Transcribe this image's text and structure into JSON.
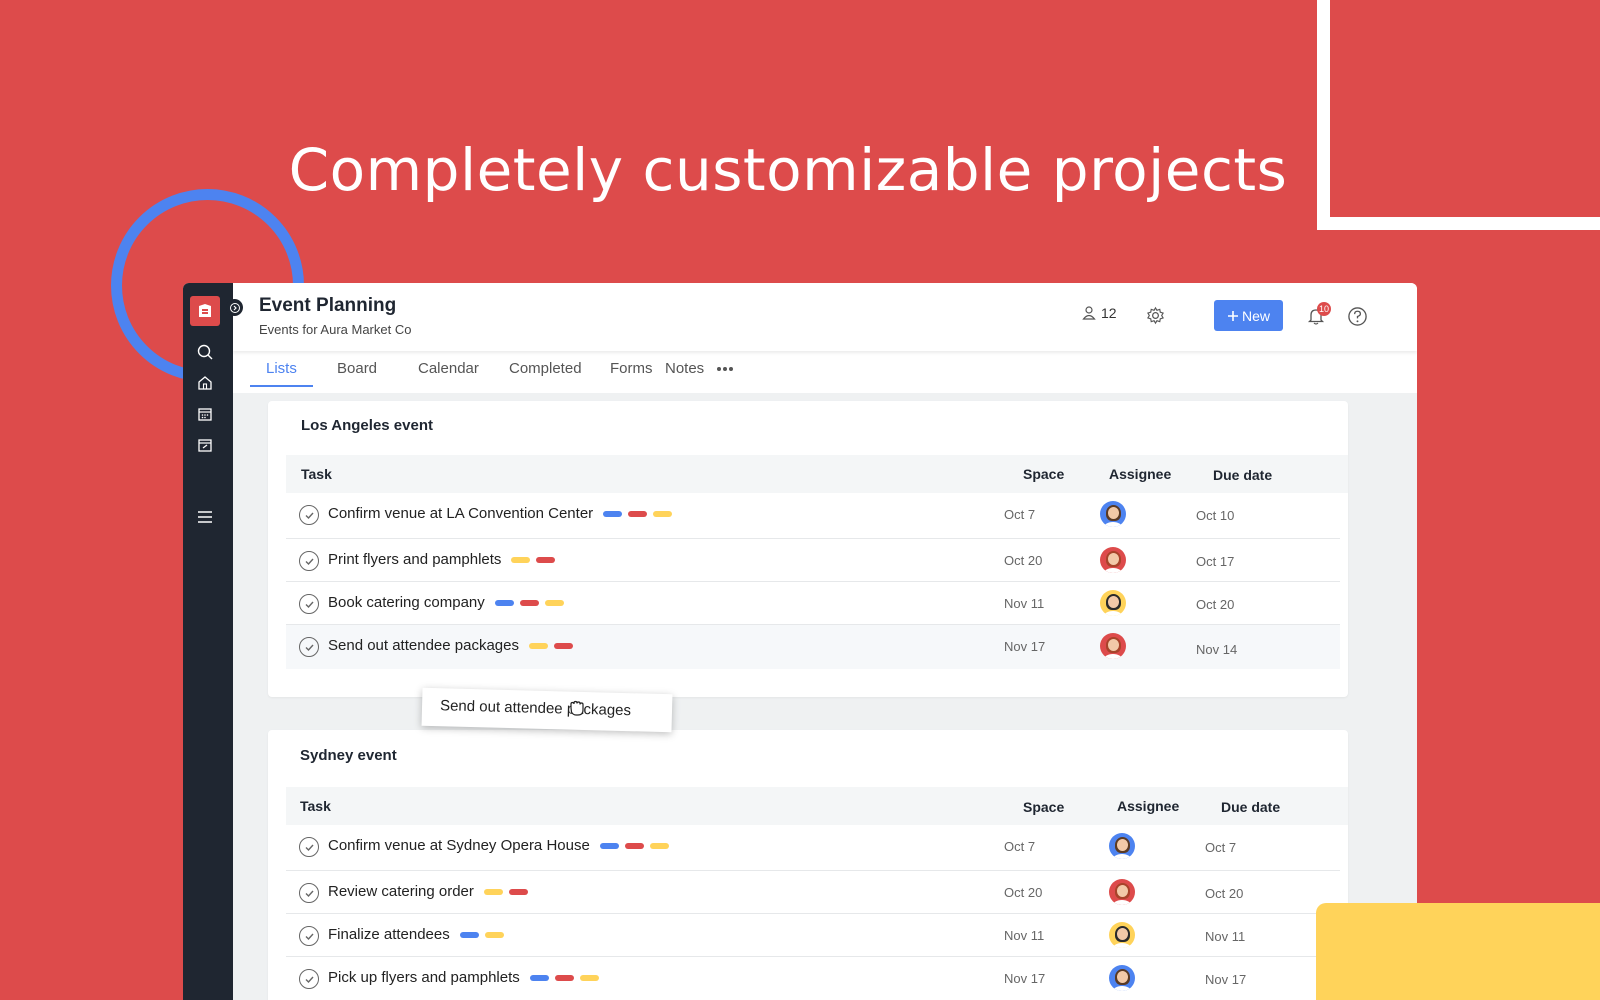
{
  "hero": {
    "title": "Completely customizable projects"
  },
  "header": {
    "title": "Event Planning",
    "subtitle": "Events for Aura Market Co",
    "members_count": "12",
    "new_label": "New",
    "notification_count": "10"
  },
  "tabs": [
    {
      "label": "Lists"
    },
    {
      "label": "Board"
    },
    {
      "label": "Calendar"
    },
    {
      "label": "Completed"
    },
    {
      "label": "Forms"
    },
    {
      "label": "Notes"
    }
  ],
  "columns": {
    "task": "Task",
    "space": "Space",
    "assignee": "Assignee",
    "due": "Due date"
  },
  "sections": [
    {
      "title": "Los Angeles event",
      "rows": [
        {
          "task": "Confirm venue at LA Convention Center",
          "tags": [
            "blue",
            "red",
            "yellow"
          ],
          "space": "Oct 7",
          "assignee": "blue",
          "due": "Oct 10"
        },
        {
          "task": "Print flyers and pamphlets",
          "tags": [
            "yellow",
            "red"
          ],
          "space": "Oct 20",
          "assignee": "red",
          "due": "Oct 17"
        },
        {
          "task": "Book catering company",
          "tags": [
            "blue",
            "red",
            "yellow"
          ],
          "space": "Nov 11",
          "assignee": "yellow",
          "due": "Oct 20"
        },
        {
          "task": "Send out attendee packages",
          "tags": [
            "yellow",
            "red"
          ],
          "space": "Nov 17",
          "assignee": "red",
          "due": "Nov 14"
        }
      ]
    },
    {
      "title": "Sydney event",
      "rows": [
        {
          "task": "Confirm venue at Sydney Opera House",
          "tags": [
            "blue",
            "red",
            "yellow"
          ],
          "space": "Oct 7",
          "assignee": "blue",
          "due": "Oct 7"
        },
        {
          "task": "Review catering order",
          "tags": [
            "yellow",
            "red"
          ],
          "space": "Oct 20",
          "assignee": "red",
          "due": "Oct 20"
        },
        {
          "task": "Finalize attendees",
          "tags": [
            "blue",
            "yellow"
          ],
          "space": "Nov 11",
          "assignee": "yellow",
          "due": "Nov 11"
        },
        {
          "task": "Pick up flyers and pamphlets",
          "tags": [
            "blue",
            "red",
            "yellow"
          ],
          "space": "Nov 17",
          "assignee": "blue",
          "due": "Nov 17"
        }
      ]
    }
  ],
  "drag_ghost": {
    "text": "Send out attendee packages"
  },
  "colors": {
    "brand_red": "#DD4B4B",
    "accent_blue": "#4D83F0",
    "tag_yellow": "#FFD35A",
    "sidebar": "#1F2631"
  },
  "icons": [
    "logo-icon",
    "search-icon",
    "home-icon",
    "calendar-icon",
    "tasks-icon",
    "menu-icon",
    "collapse-chevron-icon",
    "members-icon",
    "gear-icon",
    "plus-icon",
    "bell-icon",
    "help-icon",
    "more-icon",
    "check-icon",
    "grab-hand-icon"
  ]
}
